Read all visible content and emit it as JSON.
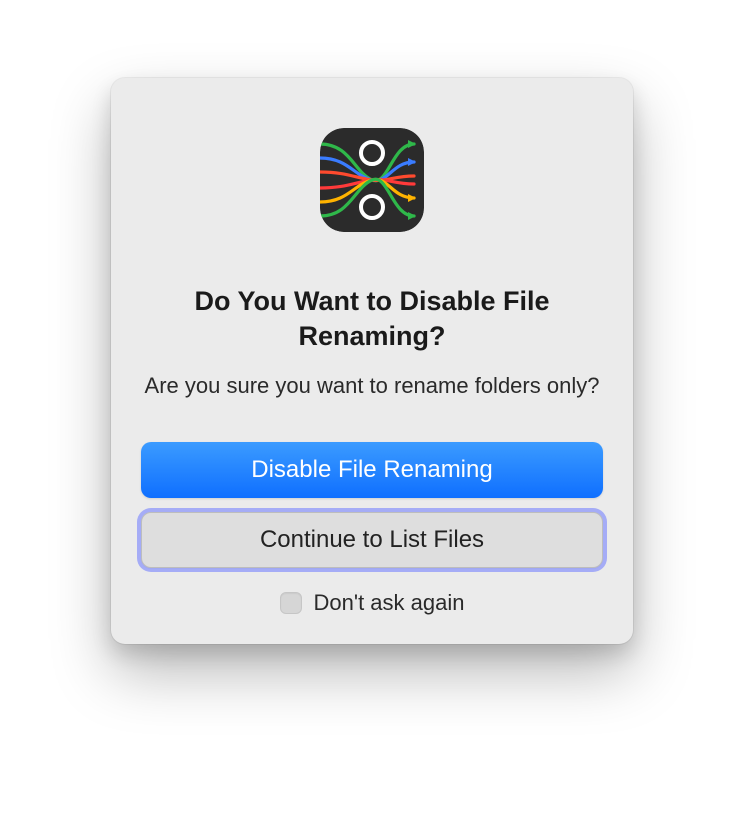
{
  "dialog": {
    "title": "Do You Want to Disable File Renaming?",
    "message": "Are you sure you want to rename folders only?",
    "primary_button": "Disable File Renaming",
    "secondary_button": "Continue to List Files",
    "checkbox_label": "Don't ask again",
    "checkbox_checked": false
  },
  "app_icon": {
    "name": "app-icon",
    "colors": {
      "bg": "#2b2b2b",
      "circle": "#ffffff",
      "lines": [
        "#3a7cff",
        "#00b2d6",
        "#ffb300",
        "#ff4a2e",
        "#ff3a3a",
        "#2fb84a"
      ]
    }
  }
}
